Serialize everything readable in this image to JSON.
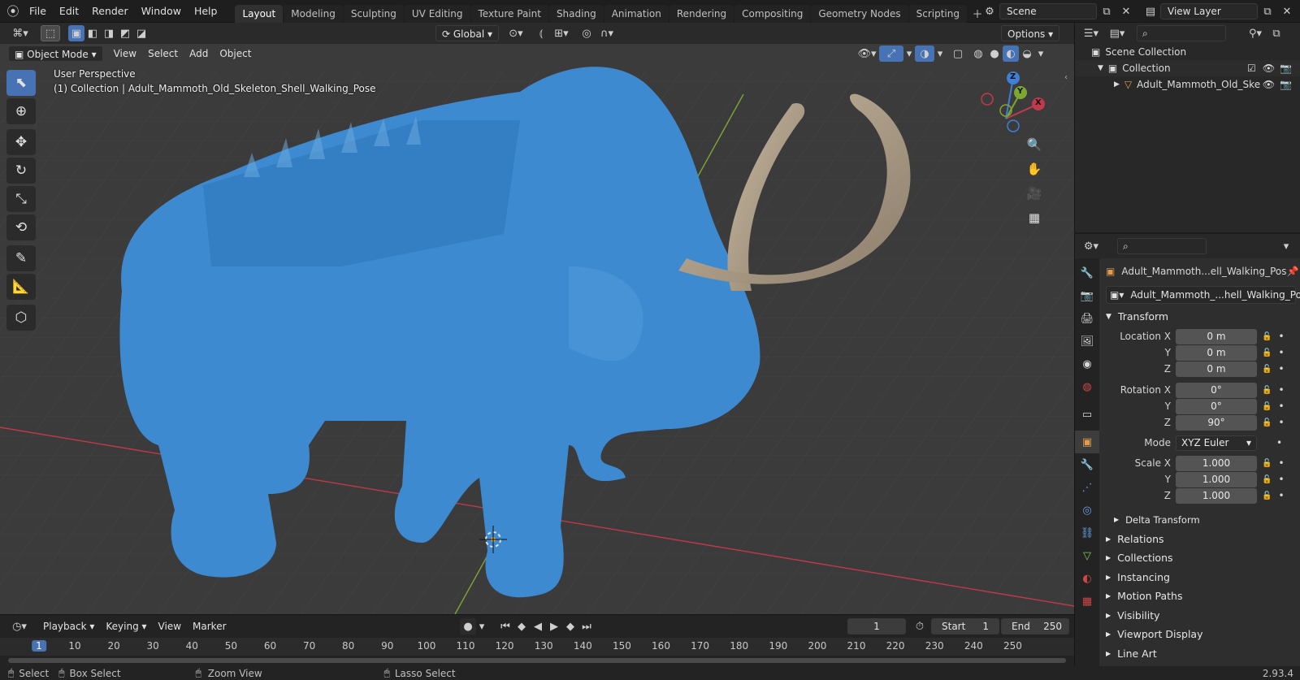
{
  "menubar": {
    "items": [
      "File",
      "Edit",
      "Render",
      "Window",
      "Help"
    ],
    "workspaces": [
      "Layout",
      "Modeling",
      "Sculpting",
      "UV Editing",
      "Texture Paint",
      "Shading",
      "Animation",
      "Rendering",
      "Compositing",
      "Geometry Nodes",
      "Scripting"
    ],
    "active_workspace": "Layout",
    "scene": "Scene",
    "view_layer": "View Layer"
  },
  "viewport": {
    "mode": "Object Mode",
    "menus": [
      "View",
      "Select",
      "Add",
      "Object"
    ],
    "transform_orientation": "Global",
    "options": "Options",
    "perspective": "User Perspective",
    "collection_label": "(1) Collection | Adult_Mammoth_Old_Skeleton_Shell_Walking_Pose",
    "gizmo": {
      "x": "X",
      "y": "Y",
      "z": "Z"
    }
  },
  "timeline": {
    "menus": [
      "Playback",
      "Keying",
      "View",
      "Marker"
    ],
    "current_frame": "1",
    "start_label": "Start",
    "start": "1",
    "end_label": "End",
    "end": "250",
    "ticks": [
      "1",
      "10",
      "20",
      "30",
      "40",
      "50",
      "60",
      "70",
      "80",
      "90",
      "100",
      "110",
      "120",
      "130",
      "140",
      "150",
      "160",
      "170",
      "180",
      "190",
      "200",
      "210",
      "220",
      "230",
      "240",
      "250"
    ]
  },
  "statusbar": {
    "select": "Select",
    "box_select": "Box Select",
    "zoom_view": "Zoom View",
    "lasso_select": "Lasso Select",
    "version": "2.93.4"
  },
  "outliner": {
    "scene_collection": "Scene Collection",
    "collection": "Collection",
    "object": "Adult_Mammoth_Old_Ske"
  },
  "properties": {
    "object_name": "Adult_Mammoth...ell_Walking_Pos",
    "data_name": "Adult_Mammoth_...hell_Walking_Pose",
    "transform_title": "Transform",
    "location_label": "Location X",
    "rotation_label": "Rotation X",
    "scale_label": "Scale X",
    "y_label": "Y",
    "z_label": "Z",
    "location": [
      "0 m",
      "0 m",
      "0 m"
    ],
    "rotation": [
      "0°",
      "0°",
      "90°"
    ],
    "mode_label": "Mode",
    "mode": "XYZ Euler",
    "scale": [
      "1.000",
      "1.000",
      "1.000"
    ],
    "delta_transform": "Delta Transform",
    "sections": [
      "Relations",
      "Collections",
      "Instancing",
      "Motion Paths",
      "Visibility",
      "Viewport Display",
      "Line Art"
    ]
  },
  "colors": {
    "accent": "#4772b3",
    "mammoth": "#3d8ad0",
    "tusk": "#a89a85",
    "axis_x": "#c0394c",
    "axis_y": "#7ea632"
  }
}
